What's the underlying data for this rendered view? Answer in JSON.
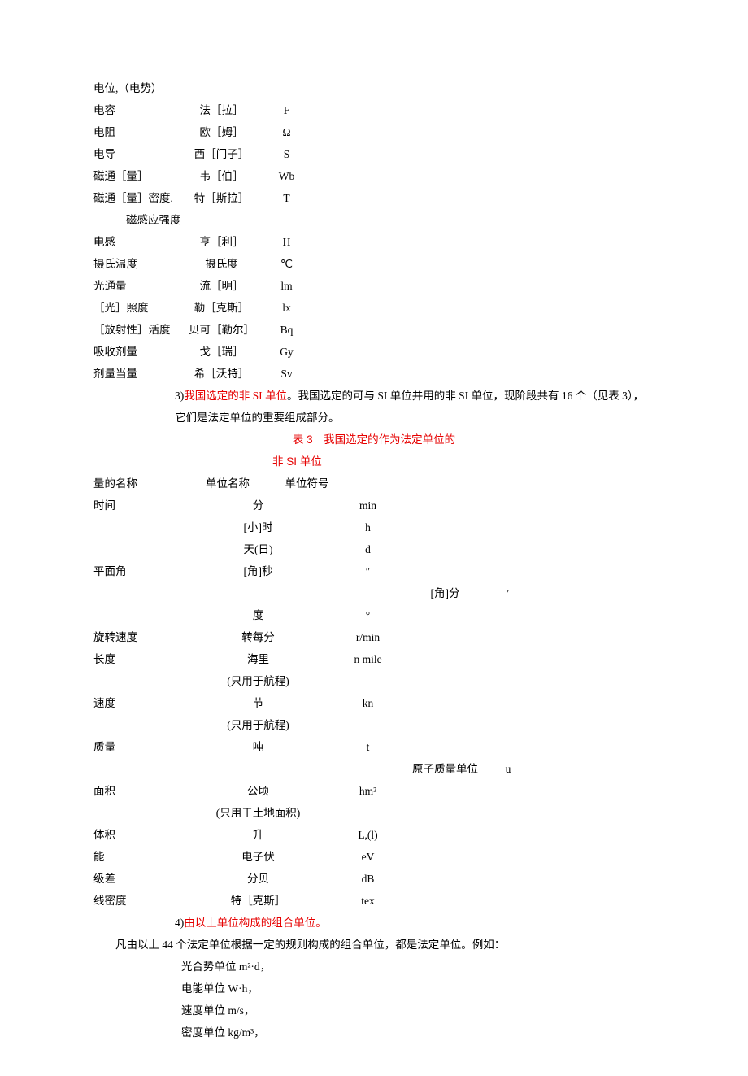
{
  "table1": {
    "rows": [
      {
        "q": "电位,（电势）",
        "n": "",
        "s": ""
      },
      {
        "q": "电容",
        "n": "法［拉］",
        "s": "F"
      },
      {
        "q": "电阻",
        "n": "欧［姆］",
        "s": "Ω"
      },
      {
        "q": "电导",
        "n": "西［门子］",
        "s": "S"
      },
      {
        "q": "磁通［量］",
        "n": "韦［伯］",
        "s": "Wb"
      },
      {
        "q": "磁通［量］密度,",
        "n": "特［斯拉］",
        "s": "T"
      },
      {
        "q": "",
        "n": "",
        "s": "",
        "indent": "磁感应强度"
      },
      {
        "q": "电感",
        "n": "亨［利］",
        "s": "H"
      },
      {
        "q": "摄氏温度",
        "n": "摄氏度",
        "s": "℃"
      },
      {
        "q": "光通量",
        "n": "流［明］",
        "s": "lm"
      },
      {
        "q": "［光］照度",
        "n": "勒［克斯］",
        "s": "lx"
      },
      {
        "q": "［放射性］活度",
        "n": "贝可［勒尔］",
        "s": "Bq"
      },
      {
        "q": "吸收剂量",
        "n": "戈［瑞］",
        "s": "Gy"
      },
      {
        "q": "剂量当量",
        "n": "希［沃特］",
        "s": "Sv"
      }
    ]
  },
  "section3": {
    "lead": "3)",
    "redPart": "我国选定的非 SI 单位",
    "rest": "。我国选定的可与 SI 单位并用的非 SI 单位，现阶段共有 16 个（见表 3），它们是法定单位的重要组成部分。"
  },
  "caption": {
    "line1": "表 3　我国选定的作为法定单位的",
    "line2": "非 SI 单位"
  },
  "table2": {
    "head": {
      "q": "量的名称",
      "n": "单位名称",
      "s": "单位符号"
    },
    "rows": [
      {
        "q": "时间",
        "n": "分",
        "s": "min"
      },
      {
        "q": "",
        "n": "[小]时",
        "s": "h"
      },
      {
        "q": "",
        "n": "天(日)",
        "s": "d"
      },
      {
        "q": "平面角",
        "n": "[角]秒",
        "s": "″"
      },
      {
        "q": "",
        "n": "",
        "s": "",
        "e1": "[角]分",
        "e2": "′"
      },
      {
        "q": "",
        "n": "度",
        "s": "°"
      },
      {
        "q": "旋转速度",
        "n": "转每分",
        "s": "r/min"
      },
      {
        "q": "长度",
        "n": "海里",
        "s": "n mile"
      },
      {
        "note": "(只用于航程)"
      },
      {
        "q": "速度",
        "n": "节",
        "s": "kn"
      },
      {
        "note": "(只用于航程)"
      },
      {
        "q": "质量",
        "n": "吨",
        "s": "t"
      },
      {
        "q": "",
        "n": "",
        "s": "",
        "e1": "原子质量单位",
        "e2": "u"
      },
      {
        "q": "面积",
        "n": "公顷",
        "s": "hm²"
      },
      {
        "note": "(只用于土地面积)"
      },
      {
        "q": "体积",
        "n": "升",
        "s": "L,(l)"
      },
      {
        "q": "能",
        "n": "电子伏",
        "s": "eV"
      },
      {
        "q": "级差",
        "n": "分贝",
        "s": "dB"
      },
      {
        "q": "线密度",
        "n": "特［克斯］",
        "s": "tex"
      }
    ]
  },
  "section4": {
    "lead": "4)",
    "red": "由以上单位构成的组合单位。"
  },
  "para": "凡由以上 44 个法定单位根据一定的规则构成的组合单位，都是法定单位。例如：",
  "examples": [
    "光合势单位 m²·d，",
    "电能单位 W·h，",
    "速度单位 m/s，",
    "密度单位 kg/m³，"
  ]
}
